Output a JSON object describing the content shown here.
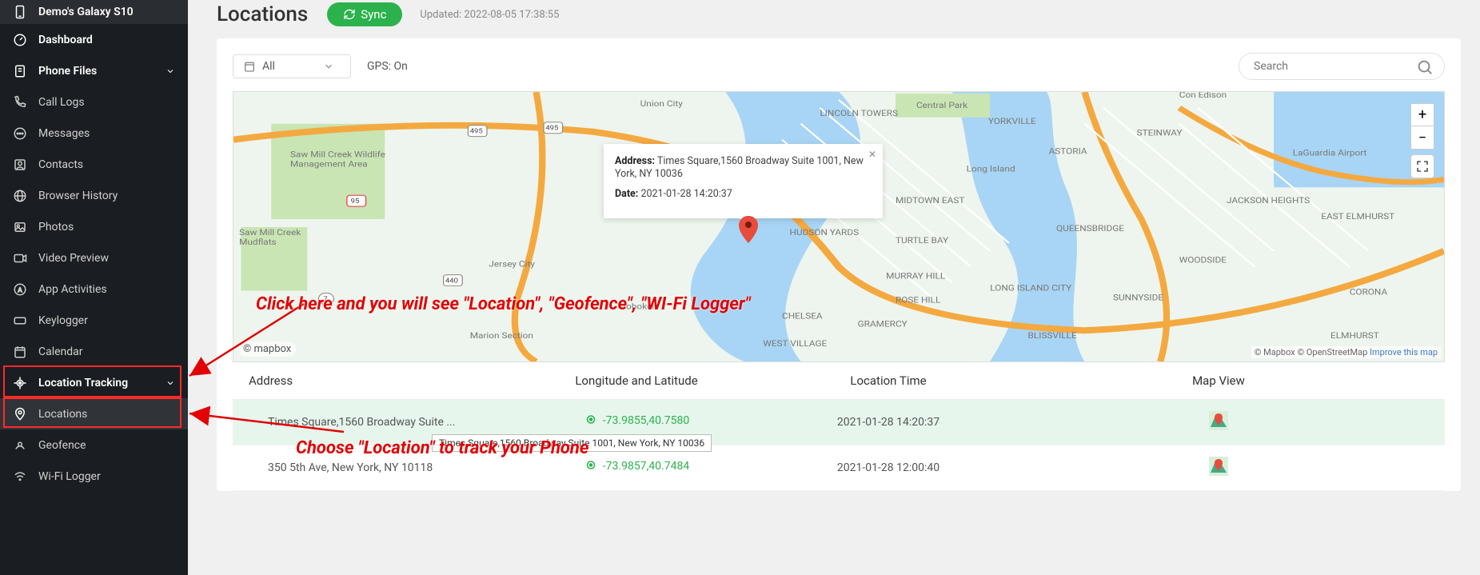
{
  "sidebar": {
    "device": "Demo's Galaxy S10",
    "items": [
      {
        "label": "Dashboard",
        "bold": true
      },
      {
        "label": "Phone Files",
        "bold": true,
        "expand": true
      },
      {
        "label": "Call Logs"
      },
      {
        "label": "Messages"
      },
      {
        "label": "Contacts"
      },
      {
        "label": "Browser History"
      },
      {
        "label": "Photos"
      },
      {
        "label": "Video Preview"
      },
      {
        "label": "App Activities"
      },
      {
        "label": "Keylogger"
      },
      {
        "label": "Calendar"
      },
      {
        "label": "Location Tracking",
        "bold": true,
        "expand": true
      },
      {
        "label": "Locations",
        "sub": true,
        "active": true
      },
      {
        "label": "Geofence",
        "sub": true
      },
      {
        "label": "Wi-Fi Logger",
        "sub": true
      }
    ]
  },
  "header": {
    "title": "Locations",
    "sync": "Sync",
    "updated_prefix": "Updated: ",
    "updated": "2022-08-05 17:38:55"
  },
  "toolbar": {
    "filter": "All",
    "gps": "GPS: On",
    "search_placeholder": "Search"
  },
  "callout": {
    "addr_label": "Address:",
    "addr": "Times Square,1560 Broadway Suite 1001, New York, NY 10036",
    "date_label": "Date:",
    "date": "2021-01-28 14:20:37"
  },
  "map": {
    "attribution": "© Mapbox © OpenStreetMap",
    "improve": "Improve this map",
    "logo": "© mapbox"
  },
  "table": {
    "headers": {
      "address": "Address",
      "lonlat": "Longitude and Latitude",
      "time": "Location Time",
      "mapview": "Map View"
    },
    "rows": [
      {
        "address": "Times Square,1560 Broadway Suite ...",
        "lonlat": "-73.9855,40.7580",
        "time": "2021-01-28 14:20:37"
      },
      {
        "address": "350 5th Ave, New York, NY 10118",
        "lonlat": "-73.9857,40.7484",
        "time": "2021-01-28 12:00:40"
      }
    ]
  },
  "tooltip": "Times Square,1560 Broadway Suite 1001, New York, NY 10036",
  "annotations": {
    "line1": "Click here and you will see \"Location\",  \"Geofence\", \"WI-Fi Logger\"",
    "line2": "Choose \"Location\" to track your Phone"
  }
}
